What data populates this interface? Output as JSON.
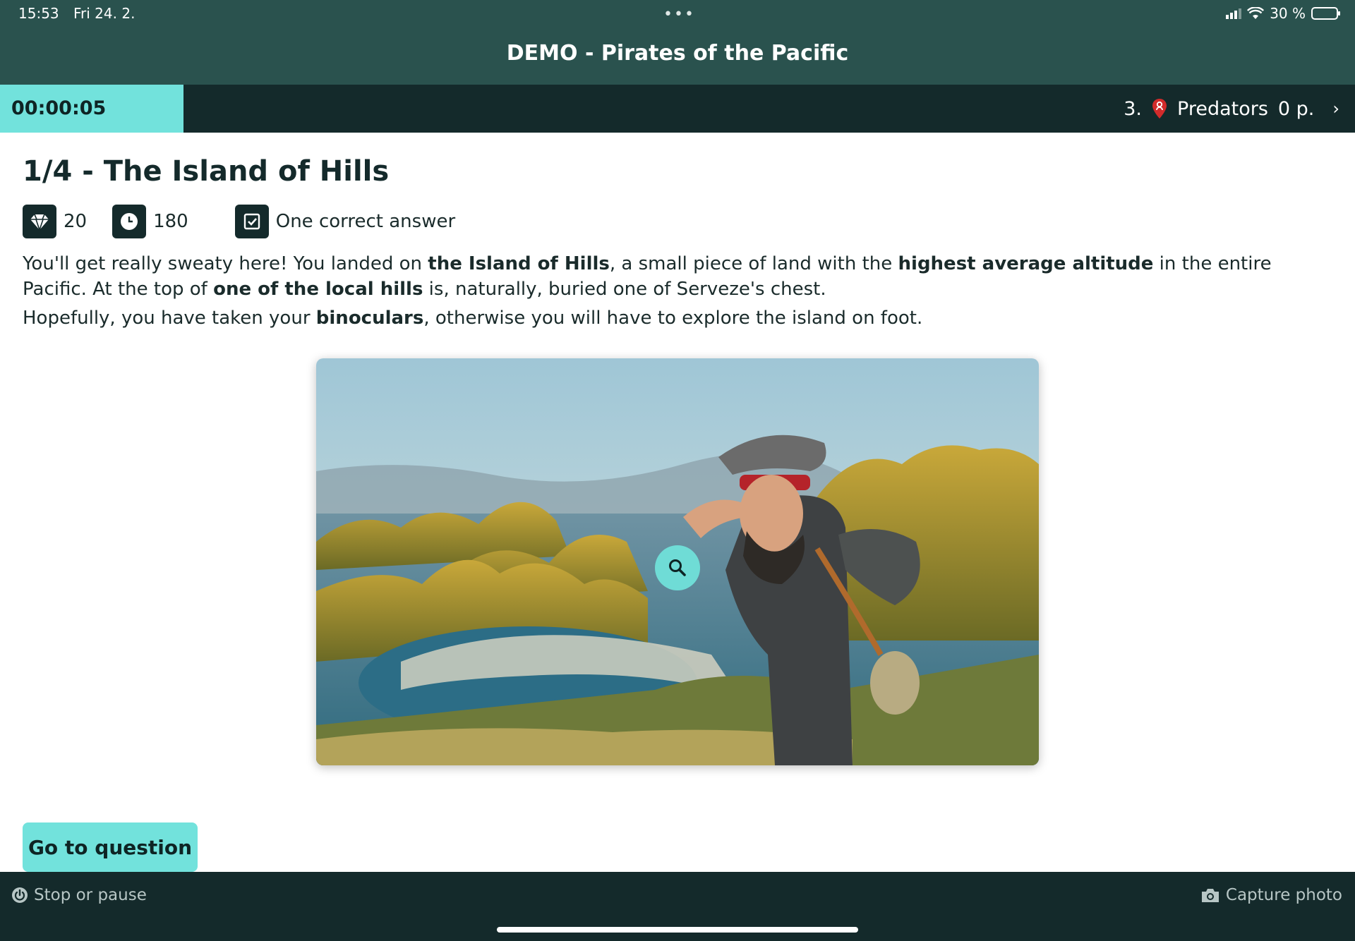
{
  "status": {
    "time": "15:53",
    "date": "Fri 24. 2.",
    "dots": "•••",
    "battery_text": "30 %",
    "battery_level": 0.3
  },
  "app": {
    "title": "DEMO - Pirates of the Pacific"
  },
  "teambar": {
    "timer": "00:00:05",
    "rank": "3.",
    "team_name": "Predators",
    "points": "0 p.",
    "chevron": "›"
  },
  "task": {
    "title": "1/4 - The Island of Hills",
    "points": "20",
    "time_limit": "180",
    "answer_type": "One correct answer",
    "desc1": [
      {
        "t": "You'll get really sweaty here! You landed on ",
        "b": false
      },
      {
        "t": "the Island of Hills",
        "b": true
      },
      {
        "t": ", a small piece of land with the ",
        "b": false
      },
      {
        "t": "highest average altitude",
        "b": true
      },
      {
        "t": " in the entire Pacific. At the top of ",
        "b": false
      },
      {
        "t": "one of the local hills",
        "b": true
      },
      {
        "t": " is, naturally, buried one of Serveze's chest.",
        "b": false
      }
    ],
    "desc2": [
      {
        "t": "Hopefully, you have taken your ",
        "b": false
      },
      {
        "t": "binoculars",
        "b": true
      },
      {
        "t": ", otherwise you will have to explore the island on foot.",
        "b": false
      }
    ]
  },
  "actions": {
    "go_to_question": "Go to question",
    "stop_or_pause": "Stop or pause",
    "capture_photo": "Capture photo"
  },
  "icons": {
    "points": "diamond-icon",
    "time": "clock-icon",
    "answer_type": "checkbox-icon",
    "zoom": "search-icon",
    "stop": "power-icon",
    "capture": "camera-icon",
    "team": "location-pin-icon"
  },
  "colors": {
    "header": "#2a524e",
    "dark": "#142a2b",
    "accent": "#72e2dc"
  }
}
